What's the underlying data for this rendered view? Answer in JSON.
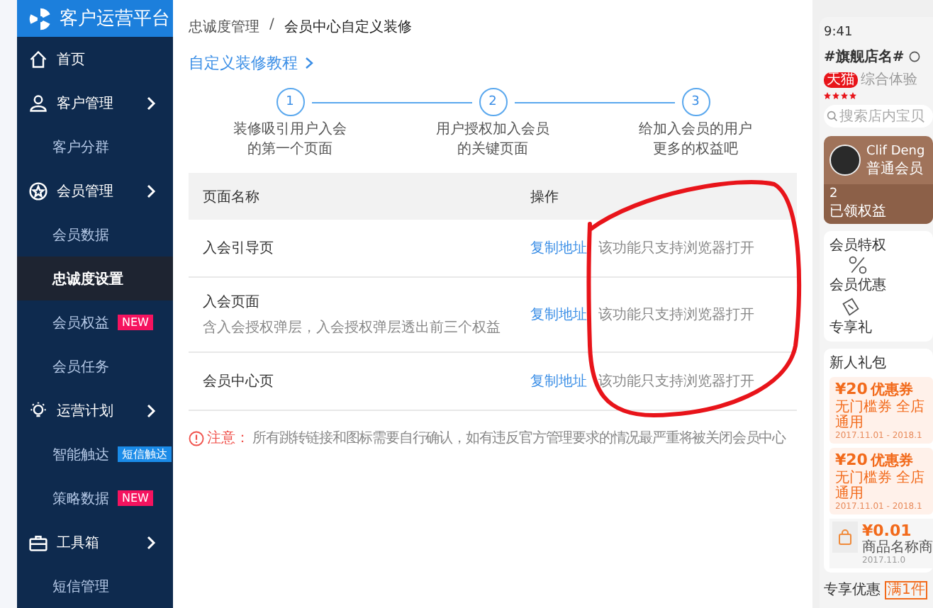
{
  "sidebar": {
    "title": "客户运营平台",
    "items": [
      {
        "kind": "group",
        "label": "首页",
        "expandable": false,
        "selected": false
      },
      {
        "kind": "group",
        "label": "客户管理",
        "expandable": true,
        "selected": false
      },
      {
        "kind": "sub",
        "label": "客户分群",
        "selected": false
      },
      {
        "kind": "group",
        "label": "会员管理",
        "expandable": true,
        "selected": false
      },
      {
        "kind": "sub",
        "label": "会员数据",
        "selected": false
      },
      {
        "kind": "sub",
        "label": "忠诚度设置",
        "selected": true
      },
      {
        "kind": "sub",
        "label": "会员权益",
        "selected": false,
        "badge": {
          "text": "NEW",
          "color": "#f5135f"
        }
      },
      {
        "kind": "sub",
        "label": "会员任务",
        "selected": false
      },
      {
        "kind": "group",
        "label": "运营计划",
        "expandable": true,
        "selected": false
      },
      {
        "kind": "sub",
        "label": "智能触达",
        "selected": false,
        "badge": {
          "text": "短信触达",
          "color": "#1a8be8"
        }
      },
      {
        "kind": "sub",
        "label": "策略数据",
        "selected": false,
        "badge": {
          "text": "NEW",
          "color": "#f5135f"
        }
      },
      {
        "kind": "group",
        "label": "工具箱",
        "expandable": true,
        "selected": false
      },
      {
        "kind": "sub",
        "label": "短信管理",
        "selected": false
      }
    ]
  },
  "breadcrumb": {
    "separator": "/",
    "items": [
      "忠诚度管理",
      "会员中心自定义装修"
    ]
  },
  "tutorial_link": "自定义装修教程",
  "steps": [
    {
      "number": "1",
      "lines": [
        "装修吸引用户入会",
        "的第一个页面"
      ]
    },
    {
      "number": "2",
      "lines": [
        "用户授权加入会员",
        "的关键页面"
      ]
    },
    {
      "number": "3",
      "lines": [
        "给加入会员的用户",
        "更多的权益吧"
      ]
    }
  ],
  "table": {
    "columns": [
      "页面名称",
      "操作"
    ],
    "rows": [
      {
        "name": "入会引导页",
        "action": "复制地址",
        "note": "该功能只支持浏览器打开"
      },
      {
        "name": "入会页面",
        "description": "含入会授权弹层，入会授权弹层透出前三个权益",
        "action": "复制地址",
        "note": "该功能只支持浏览器打开"
      },
      {
        "name": "会员中心页",
        "action": "复制地址",
        "note": "该功能只支持浏览器打开"
      }
    ]
  },
  "notice": {
    "label": "注意：",
    "text": "所有跳转链接和图标需要自行确认，如有违反官方管理要求的情况最严重将被关闭会员中心"
  },
  "preview": {
    "time": "9:41",
    "shop_name": "#旗舰店名#",
    "shop_badge": "天猫",
    "rating_label": "综合体验",
    "stars": 4,
    "search_placeholder": "搜索店内宝贝",
    "member": {
      "name": "Clif Deng",
      "level": "普通会员",
      "count": "2",
      "count_label": "已领权益"
    },
    "privileges": {
      "title": "会员特权",
      "items": [
        "会员优惠",
        "专享礼"
      ]
    },
    "gift": {
      "title": "新人礼包",
      "coupons": [
        {
          "kind": "coupon",
          "amount": "¥20",
          "type": "优惠券",
          "condition": "无门槛券 全店通用",
          "period": "2017.11.01 - 2018.1"
        },
        {
          "kind": "coupon",
          "amount": "¥20",
          "type": "优惠券",
          "condition": "无门槛券 全店通用",
          "period": "2017.11.01 - 2018.1"
        },
        {
          "kind": "product",
          "amount": "¥0.01",
          "condition": "商品名称商",
          "period": "2017.11.0"
        }
      ]
    },
    "exclusive": {
      "title": "专享优惠",
      "tag": "满1件"
    }
  }
}
